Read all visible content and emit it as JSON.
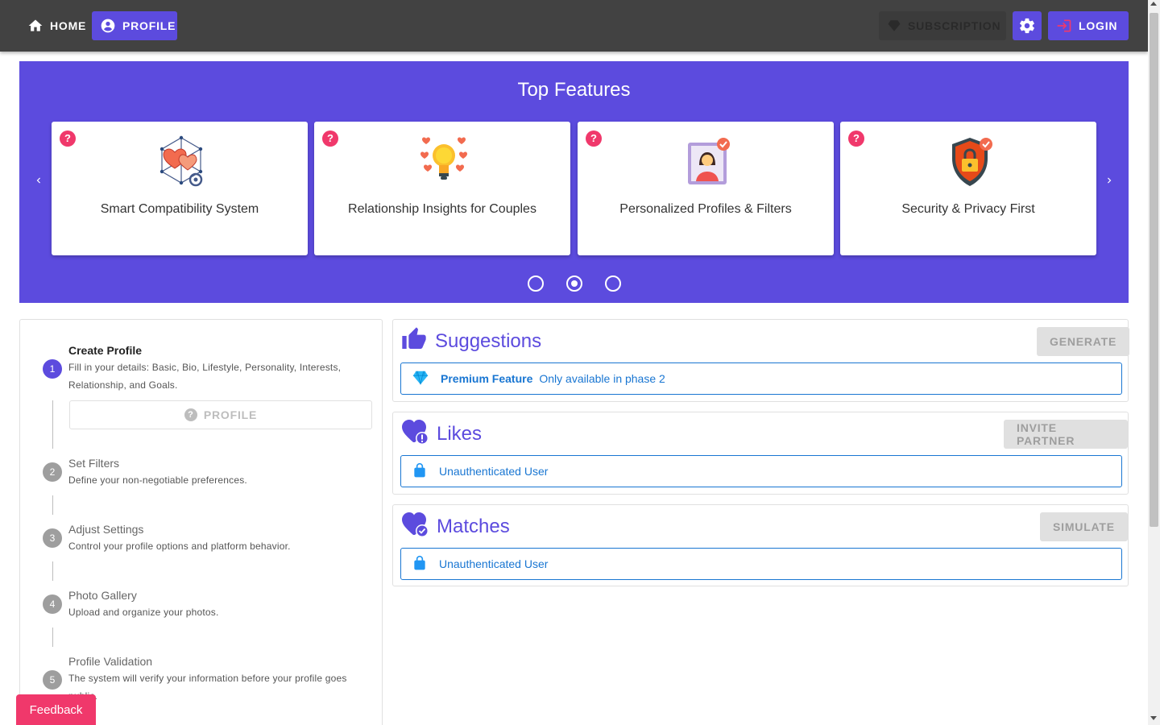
{
  "nav": {
    "home": "Home",
    "profile": "Profile",
    "subscription": "Subscription",
    "settings_icon": "gear-icon",
    "login": "Login"
  },
  "features": {
    "title": "Top Features",
    "cards": [
      {
        "title": "Smart Compatibility System",
        "icon": "hearts-network-icon"
      },
      {
        "title": "Relationship Insights for Couples",
        "icon": "lightbulb-hearts-icon"
      },
      {
        "title": "Personalized Profiles & Filters",
        "icon": "profile-photo-icon"
      },
      {
        "title": "Security & Privacy First",
        "icon": "shield-lock-icon"
      }
    ],
    "help_badge": "?",
    "active_page": 2,
    "page_count": 3
  },
  "steps": [
    {
      "num": "1",
      "title": "Create Profile",
      "desc": "Fill in your details: Basic, Bio, Lifestyle, Personality, Interests, Relationship, and Goals.",
      "button": "Profile"
    },
    {
      "num": "2",
      "title": "Set Filters",
      "desc": "Define your non-negotiable preferences."
    },
    {
      "num": "3",
      "title": "Adjust Settings",
      "desc": "Control your profile options and platform behavior."
    },
    {
      "num": "4",
      "title": "Photo Gallery",
      "desc": "Upload and organize your photos."
    },
    {
      "num": "5",
      "title": "Profile Validation",
      "desc": "The system will verify your information before your profile goes public."
    }
  ],
  "panels": {
    "suggestions": {
      "title": "Suggestions",
      "action": "Generate",
      "alert_strong": "Premium Feature",
      "alert_text": "Only available in phase 2"
    },
    "likes": {
      "title": "Likes",
      "action": "Invite Partner",
      "alert_text": "Unauthenticated User"
    },
    "matches": {
      "title": "Matches",
      "action": "Simulate",
      "alert_text": "Unauthenticated User"
    }
  },
  "feedback": "Feedback",
  "colors": {
    "primary": "#5c4bde",
    "accent": "#f0386b",
    "info": "#1976d2",
    "appbar": "#424242"
  }
}
